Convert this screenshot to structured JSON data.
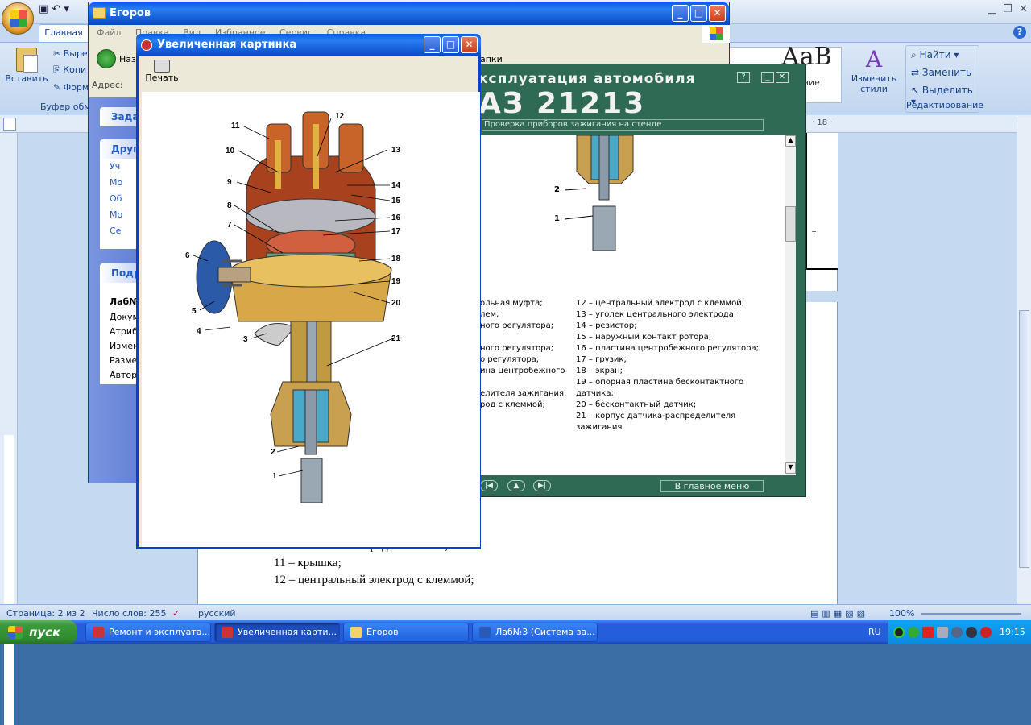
{
  "word": {
    "tab_home": "Главная",
    "clipboard": {
      "paste": "Вставить",
      "cut": "Выре",
      "copy": "Копи",
      "format": "Форм",
      "group": "Буфер обм"
    },
    "styles": {
      "sample": "АаВ",
      "normal_label": "ание",
      "change_styles": "Изменить\nстили"
    },
    "editing": {
      "find": "Найти",
      "replace": "Заменить",
      "select": "Выделить",
      "group": "Редактирование"
    },
    "ruler_value": "· 18 ·",
    "doc_lines": [
      "10 – боковой электрод с клеммой;",
      "11 – крышка;",
      "12 – центральный электрод с клеммой;"
    ],
    "table_fragment": "т",
    "status": {
      "page": "Страница: 2 из 2",
      "words": "Число слов: 255",
      "lang": "русский",
      "zoom": "100%"
    }
  },
  "explorer": {
    "title": "Егоров",
    "menu": "Файл Правка Вид Избранное Сервис Справка",
    "back": "Наза",
    "addr_label": "Адрес:",
    "panels": [
      {
        "title": "Задач",
        "items": []
      },
      {
        "title": "Други",
        "items": [
          "Уч",
          "Мо",
          "Об",
          "Мо",
          "Се"
        ]
      },
      {
        "title": "Подро",
        "items": [
          "Лаб№",
          "Докум",
          "Атриб",
          "Измене",
          "Размер",
          "Автор"
        ]
      }
    ],
    "addr_tail": "апки"
  },
  "program": {
    "title1": "ксплуатация автомобиля",
    "title2": "АЗ 21213",
    "subtitle": "Проверка приборов зажигания на стенде",
    "legend_left": [
      "ольная муфта;",
      "лем;",
      "ного регулятора;",
      "",
      "ного регулятора;",
      "о регулятора;",
      "ина центробежного",
      "",
      "елителя зажигания;",
      "род с клеммой;"
    ],
    "legend_right": [
      "12 – центральный электрод с клеммой;",
      "13 – уголек центрального электрода;",
      "14 – резистор;",
      "15 – наружный контакт ротора;",
      "16 – пластина центробежного регулятора;",
      "17 – грузик;",
      "18 – экран;",
      "19 – опорная пластина бесконтактного",
      "датчика;",
      "20 – бесконтактный датчик;",
      "21 – корпус датчика-распределителя",
      "зажигания"
    ],
    "part_labels": [
      "2",
      "1"
    ],
    "main_menu": "В главное меню"
  },
  "zoom": {
    "title": "Увеличенная картинка",
    "print": "Печать",
    "callouts": [
      "11",
      "12",
      "10",
      "13",
      "9",
      "14",
      "15",
      "8",
      "16",
      "7",
      "17",
      "6",
      "18",
      "19",
      "5",
      "20",
      "4",
      "3",
      "21",
      "2",
      "1"
    ]
  },
  "taskbar": {
    "start": "пуск",
    "items": [
      {
        "label": "Ремонт и эксплуата...",
        "active": false
      },
      {
        "label": "Увеличенная карти...",
        "active": true
      },
      {
        "label": "Егоров",
        "active": false
      },
      {
        "label": "Лаб№3 (Система за...",
        "active": false
      }
    ],
    "lang": "RU",
    "clock": "19:15"
  },
  "colors": {
    "xp_blue": "#0a5ce6",
    "program_green": "#2f6a55"
  }
}
